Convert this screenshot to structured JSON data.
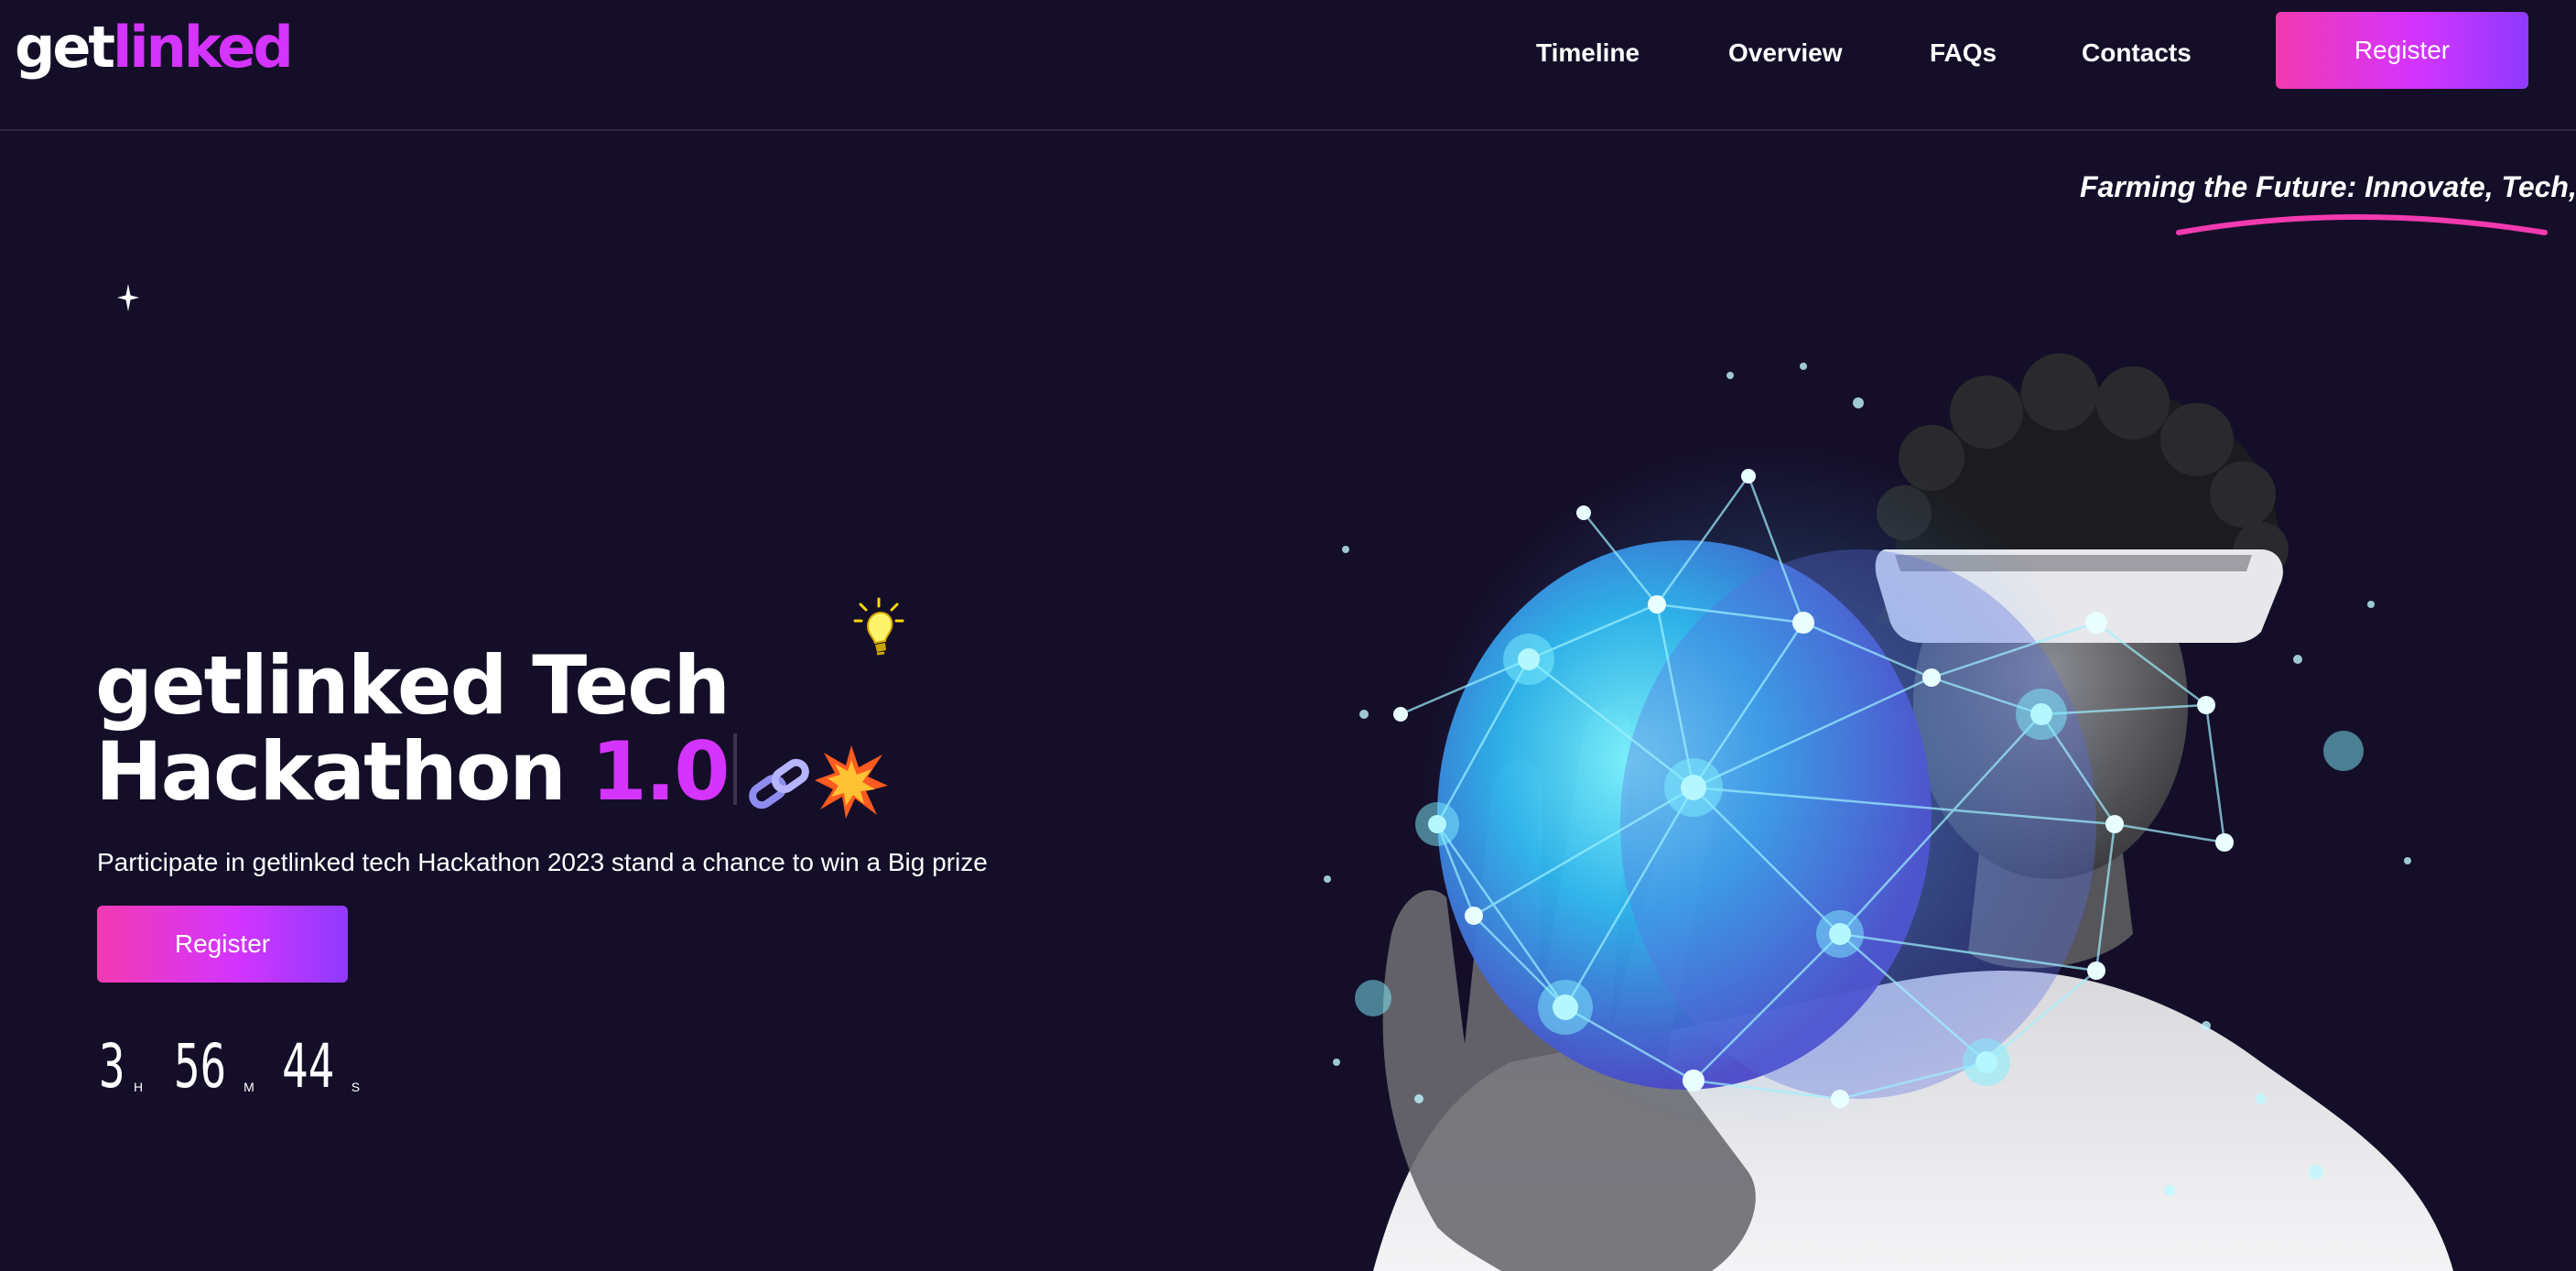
{
  "header": {
    "logo": {
      "part1": "get",
      "part2": "linked"
    },
    "nav": [
      {
        "label": "Timeline"
      },
      {
        "label": "Overview"
      },
      {
        "label": "FAQs"
      },
      {
        "label": "Contacts"
      }
    ],
    "register_label": "Register"
  },
  "hero": {
    "tagline": "Farming the Future: Innovate, Tech,|",
    "title_line1": "getlinked Tech",
    "title_line2": "Hackathon",
    "title_accent": "1.0",
    "subtitle": "Participate in getlinked tech Hackathon 2023 stand a chance to win a Big prize",
    "register_label": "Register",
    "countdown": [
      {
        "value": "3",
        "unit": "H"
      },
      {
        "value": "56",
        "unit": "M"
      },
      {
        "value": "44",
        "unit": "S"
      }
    ]
  },
  "colors": {
    "background": "#150e28",
    "accent": "#d434fe",
    "gradient_start": "#f33ab0",
    "gradient_end": "#903aff",
    "underline": "#f33ab0"
  },
  "icons": [
    "sparkle-star-icon",
    "lightbulb-icon",
    "chain-link-icon",
    "explosion-icon"
  ]
}
